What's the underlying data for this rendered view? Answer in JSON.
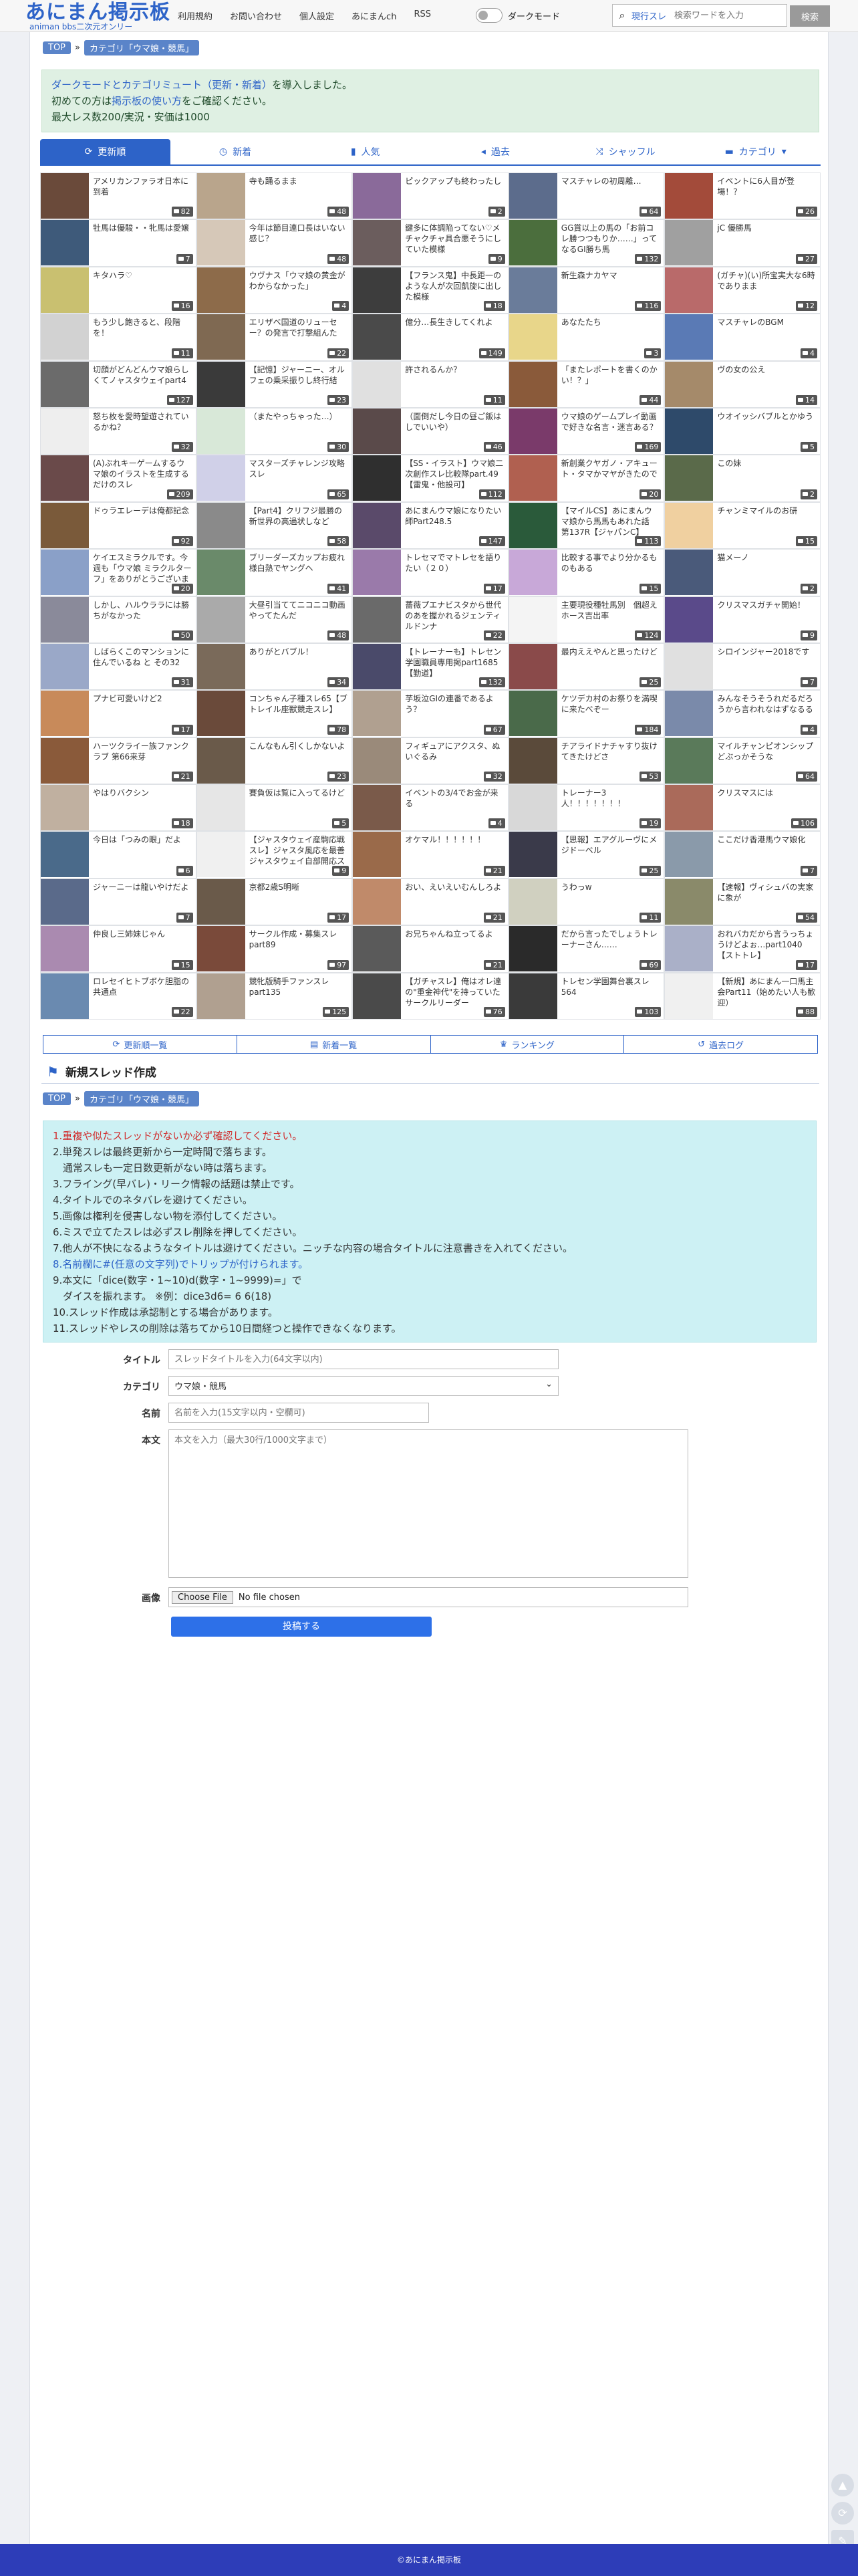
{
  "header": {
    "logo_main": "あにまん掲示板",
    "logo_sub": "animan bbs二次元オンリー",
    "nav": [
      "利用規約",
      "お問い合わせ",
      "個人設定",
      "あにまんch",
      "RSS"
    ],
    "dark_label": "ダークモード",
    "search_label": "現行スレ",
    "search_placeholder": "検索ワードを入力",
    "search_button": "検索"
  },
  "breadcrumb": {
    "top": "TOP",
    "category": "カテゴリ「ウマ娘・競馬」"
  },
  "notice": {
    "line1_link": "ダークモードとカテゴリミュート（更新・新着）",
    "line1_rest": "を導入しました。",
    "line2_a": "初めての方は",
    "line2_link": "掲示板の使い方",
    "line2_b": "をご確認ください。",
    "line3": "最大レス数200/実況・安価は1000"
  },
  "tabs": [
    "更新順",
    "新着",
    "人気",
    "過去",
    "シャッフル",
    "カテゴリ"
  ],
  "threads": [
    {
      "title": "アメリカンファラオ日本に到着",
      "count": "82",
      "c": "#6a4a3a"
    },
    {
      "title": "寺も踊るまま",
      "count": "48",
      "c": "#b9a58c"
    },
    {
      "title": "ピックアップも終わったし",
      "count": "2",
      "c": "#8a6a9a"
    },
    {
      "title": "マスチャレの初周離…",
      "count": "64",
      "c": "#5c6c8c"
    },
    {
      "title": "イベントに6人目が登場！？",
      "count": "26",
      "c": "#a34b3a"
    },
    {
      "title": "牡馬は優駿・・牝馬は愛嬢",
      "count": "7",
      "c": "#3e5a7a"
    },
    {
      "title": "今年は節目連口長はいない感じ？",
      "count": "48",
      "c": "#d6c8b8"
    },
    {
      "title": "鍵多に体調陥ってない♡メチャクチャ具合悪そうにしていた模様",
      "count": "9",
      "c": "#6b5d5d"
    },
    {
      "title": "GG賞以上の馬の「お前コレ勝つつもりか……」ってなるGI勝ち馬",
      "count": "132",
      "c": "#4b6e3d"
    },
    {
      "title": "jC 優勝馬",
      "count": "27",
      "c": "#a0a0a0"
    },
    {
      "title": "キタハラ♡",
      "count": "16",
      "c": "#c9c070"
    },
    {
      "title": "ウヴナス「ウマ娘の黄金がわからなかった」",
      "count": "4",
      "c": "#8d6b4a"
    },
    {
      "title": "【フランス鬼】中長距一のような人が次回凱旋に出した模様",
      "count": "18",
      "c": "#3d3d3d"
    },
    {
      "title": "新生森ナカヤマ",
      "count": "116",
      "c": "#6a7c9a"
    },
    {
      "title": "(ガチャ)(い)所宝実大な6時でありまま",
      "count": "12",
      "c": "#b96a6a"
    },
    {
      "title": "もう少し飽きると、段階を！",
      "count": "11",
      "c": "#d2d2d2"
    },
    {
      "title": "エリザベ国道のリューセー？の発言で打撃組んた",
      "count": "22",
      "c": "#7f6952"
    },
    {
      "title": "億分…長生きしてくれよ",
      "count": "149",
      "c": "#4a4a4a"
    },
    {
      "title": "あなたたち",
      "count": "3",
      "c": "#e8d68a"
    },
    {
      "title": "マスチャレのBGM",
      "count": "4",
      "c": "#5a7ab5"
    },
    {
      "title": "切顔がどんどんウマ娘らしくてノャスタウェイpart4",
      "count": "127",
      "c": "#6b6b6b"
    },
    {
      "title": "【記憶】ジャーニー、オルフェの乗采振りし終行結",
      "count": "23",
      "c": "#3a3a3a"
    },
    {
      "title": "許されるんか？",
      "count": "11",
      "c": "#e0e0e0"
    },
    {
      "title": "「またレポートを書くのかい！？」",
      "count": "44",
      "c": "#8a5a3a"
    },
    {
      "title": "ヴの女の公え",
      "count": "14",
      "c": "#a58a6a"
    },
    {
      "title": "怒ち枚を愛時望遊されているかね？",
      "count": "32",
      "c": "#eeeeee"
    },
    {
      "title": "（またやっちゃった…）",
      "count": "30",
      "c": "#d8e8d8"
    },
    {
      "title": "（面倒だし今日の昼ご飯はしでいいや）",
      "count": "46",
      "c": "#5a4a4a"
    },
    {
      "title": "ウマ娘のゲームプレイ動画で好きな名言・迷言ある？",
      "count": "169",
      "c": "#7a3a6a"
    },
    {
      "title": "ウオイッシバブルとかゆう",
      "count": "5",
      "c": "#2e4a6a"
    },
    {
      "title": "(A)ぶれキーゲームするウマ娘のイラストを生成するだけのスレ",
      "count": "209",
      "c": "#6a4a4a"
    },
    {
      "title": "マスターズチャレンジ攻略スレ",
      "count": "65",
      "c": "#d0d0e8"
    },
    {
      "title": "【SS・イラスト】ウマ娘二次創作スレ比較隊part.49【雷鬼・他設可】",
      "count": "112",
      "c": "#2f2f2f"
    },
    {
      "title": "新創業クヤガノ・アキュート・タマかマヤがきたので",
      "count": "20",
      "c": "#b06050"
    },
    {
      "title": "この妹",
      "count": "2",
      "c": "#5a6a4a"
    },
    {
      "title": "ドゥラエレーデは俺都記念",
      "count": "92",
      "c": "#7a5a3a"
    },
    {
      "title": "【Part4】クリフジ最勝の新世界の高過状しなど",
      "count": "58",
      "c": "#8a8a8a"
    },
    {
      "title": "あにまんウマ娘になりたい師Part248.5",
      "count": "147",
      "c": "#5a4a6a"
    },
    {
      "title": "【マイルCS】あにまんウマ娘から馬馬もあれた話 第137R【ジャパンC】",
      "count": "113",
      "c": "#2a5a3a"
    },
    {
      "title": "チャンミマイルのお研",
      "count": "15",
      "c": "#f0d0a0"
    },
    {
      "title": "ケイエスミラクルです。今週も「ウマ娘 ミラクルターフ」をありがとうございました",
      "count": "20",
      "c": "#8aa0c8"
    },
    {
      "title": "ブリーダーズカップお疲れ様白熱でヤングヘ",
      "count": "41",
      "c": "#6a8a6a"
    },
    {
      "title": "トレセマでマトレセを語りたい（２０）",
      "count": "17",
      "c": "#9a7aaa"
    },
    {
      "title": "比較する事でより分かるものもある",
      "count": "15",
      "c": "#c8a8d8"
    },
    {
      "title": "猫メーノ",
      "count": "2",
      "c": "#4a5a7a"
    },
    {
      "title": "しかし、ハルウララには勝ちがなかった",
      "count": "50",
      "c": "#8a8a9a"
    },
    {
      "title": "大昼引当ててニコニコ動画やってたんだ",
      "count": "48",
      "c": "#aaaaaa"
    },
    {
      "title": "薔薇プエナビスタから世代のあを握かれるジェンティルドンナ",
      "count": "22",
      "c": "#6a6a6a"
    },
    {
      "title": "主要現役種牡馬別　個超えホース吉出率",
      "count": "124",
      "c": "#f4f4f4"
    },
    {
      "title": "クリスマスガチャ開始！",
      "count": "9",
      "c": "#5a4a8a"
    },
    {
      "title": "しばらくこのマンションに住んでいるね と その32",
      "count": "31",
      "c": "#9aa8c8"
    },
    {
      "title": "ありがとバブル！",
      "count": "34",
      "c": "#7a6a5a"
    },
    {
      "title": "【トレーナーも】トレセン学園職員専用掲part1685【勤道】",
      "count": "132",
      "c": "#4a4a6a"
    },
    {
      "title": "最内ええやんと思ったけど",
      "count": "25",
      "c": "#8a4a4a"
    },
    {
      "title": "シロインジャー2018です",
      "count": "7",
      "c": "#e0e0e0"
    },
    {
      "title": "プナビ可愛いけど2",
      "count": "17",
      "c": "#c88a5a"
    },
    {
      "title": "コンちゃん子種スレ65【ブトレイル座獣競走スレ】",
      "count": "78",
      "c": "#6a4a3a"
    },
    {
      "title": "芋坂泣GIの連番であるよう？",
      "count": "67",
      "c": "#b0a090"
    },
    {
      "title": "ケツデカ村のお祭りを満喫に来たべぞー",
      "count": "184",
      "c": "#4a6a4a"
    },
    {
      "title": "みんなそうそうれだるだろうから言われなはずなるる",
      "count": "4",
      "c": "#7a8aaa"
    },
    {
      "title": "ハーツクライー族ファンクラブ 第66来芽",
      "count": "21",
      "c": "#8a5a3a"
    },
    {
      "title": "こんなもん引くしかないよ",
      "count": "23",
      "c": "#6a5a4a"
    },
    {
      "title": "フィギュアにアクスタ、ぬいぐるみ",
      "count": "32",
      "c": "#9a8a7a"
    },
    {
      "title": "チアライドナチャすり抜けてきたけどさ",
      "count": "53",
      "c": "#5a4a3a"
    },
    {
      "title": "マイルチャンピオンシップどぶっかそうな",
      "count": "64",
      "c": "#5a7a5a"
    },
    {
      "title": "やはりバクシン",
      "count": "18",
      "c": "#c0b0a0"
    },
    {
      "title": "賽負仮は覧に入ってるけど",
      "count": "5",
      "c": "#e6e6e6"
    },
    {
      "title": "イベントの3/4でお金が来る",
      "count": "4",
      "c": "#7a5a4a"
    },
    {
      "title": "トレーナー3人！！！！！！！",
      "count": "19",
      "c": "#d8d8d8"
    },
    {
      "title": "クリスマスには",
      "count": "106",
      "c": "#aa6a5a"
    },
    {
      "title": "今日は「つみの眼」だよ",
      "count": "6",
      "c": "#4a6a8a"
    },
    {
      "title": "【ジャスタウェイ産駒応戦スレ】ジャスタ風応を最善ジャスタウェイ自部開応スレ",
      "count": "9",
      "c": "#f0f0f0"
    },
    {
      "title": "オケマル！！！！！！",
      "count": "21",
      "c": "#9a6a4a"
    },
    {
      "title": "【思報】エアグルーヴにメジドーベル",
      "count": "25",
      "c": "#3a3a4a"
    },
    {
      "title": "ここだけ香港馬ウマ娘化",
      "count": "7",
      "c": "#8a9aaa"
    },
    {
      "title": "ジャーニーは龍いやけだよ",
      "count": "7",
      "c": "#5a6a8a"
    },
    {
      "title": "京都2歳S明晰",
      "count": "17",
      "c": "#6a5a4a"
    },
    {
      "title": "おい、えいえいむんしろよ",
      "count": "21",
      "c": "#c08a6a"
    },
    {
      "title": "うわっw",
      "count": "11",
      "c": "#d0d0c0"
    },
    {
      "title": "【速報】ヴィシュバの実家に象が",
      "count": "54",
      "c": "#8a8a6a"
    },
    {
      "title": "仲良し三姉妹じゃん",
      "count": "15",
      "c": "#aa8ab0"
    },
    {
      "title": "サークル作成・募集スレ part89",
      "count": "97",
      "c": "#7a4a3a"
    },
    {
      "title": "お兄ちゃんね立ってるよ",
      "count": "21",
      "c": "#5a5a5a"
    },
    {
      "title": "だから言ったでしょうトレーナーさん……",
      "count": "69",
      "c": "#2a2a2a"
    },
    {
      "title": "おれバカだから言うっちょうけどよぉ…part1040【ストトレ】",
      "count": "17",
      "c": "#aab0c8"
    },
    {
      "title": "ロレセイヒトブボケ胆脂の共通点",
      "count": "22",
      "c": "#6a8ab0"
    },
    {
      "title": "競牝版騎手ファンスレpart135",
      "count": "125",
      "c": "#b0a090"
    },
    {
      "title": "【ガチャスレ】俺はオレ達の\"重金神代\"を持っていたサークルリーダー",
      "count": "76",
      "c": "#4a4a4a"
    },
    {
      "title": "トレセン学園舞台裏スレ564",
      "count": "103",
      "c": "#3a3a3a"
    },
    {
      "title": "【新規】あにまん一口馬主会Part11（始めたい人も歓迎）",
      "count": "88",
      "c": "#f0f0f0"
    }
  ],
  "bottom_nav": [
    "更新順一覧",
    "新着一覧",
    "ランキング",
    "過去ログ"
  ],
  "new_thread": {
    "heading": "新規スレッド作成",
    "rules": [
      "1.重複や似たスレッドがないか必ず確認してください。",
      "2.単発スレは最終更新から一定時間で落ちます。",
      "　通常スレも一定日数更新がない時は落ちます。",
      "3.フライング(早バレ)・リーク情報の話題は禁止です。",
      "4.タイトルでのネタバレを避けてください。",
      "5.画像は権利を侵害しない物を添付してください。",
      "6.ミスで立てたスレは必ずスレ削除を押してください。",
      "7.他人が不快になるようなタイトルは避けてください。ニッチな内容の場合タイトルに注意書きを入れてください。",
      "8.名前欄に#(任意の文字列)でトリップが付けられます。",
      "9.本文に「dice(数字・1~10)d(数字・1~9999)=」で",
      "　ダイスを振れます。 ※例：dice3d6= 6 6(18)",
      "10.スレッド作成は承認制とする場合があります。",
      "11.スレッドやレスの削除は落ちてから10日間経つと操作できなくなります。"
    ],
    "labels": {
      "title": "タイトル",
      "category": "カテゴリ",
      "name": "名前",
      "body": "本文",
      "image": "画像"
    },
    "placeholders": {
      "title": "スレッドタイトルを入力(64文字以内)",
      "name": "名前を入力(15文字以内・空欄可)",
      "body": "本文を入力（最大30行/1000文字まで）"
    },
    "category_value": "ウマ娘・競馬",
    "file_button": "Choose File",
    "file_status": "No file chosen",
    "submit": "投稿する"
  },
  "footer": "©あにまん掲示板"
}
